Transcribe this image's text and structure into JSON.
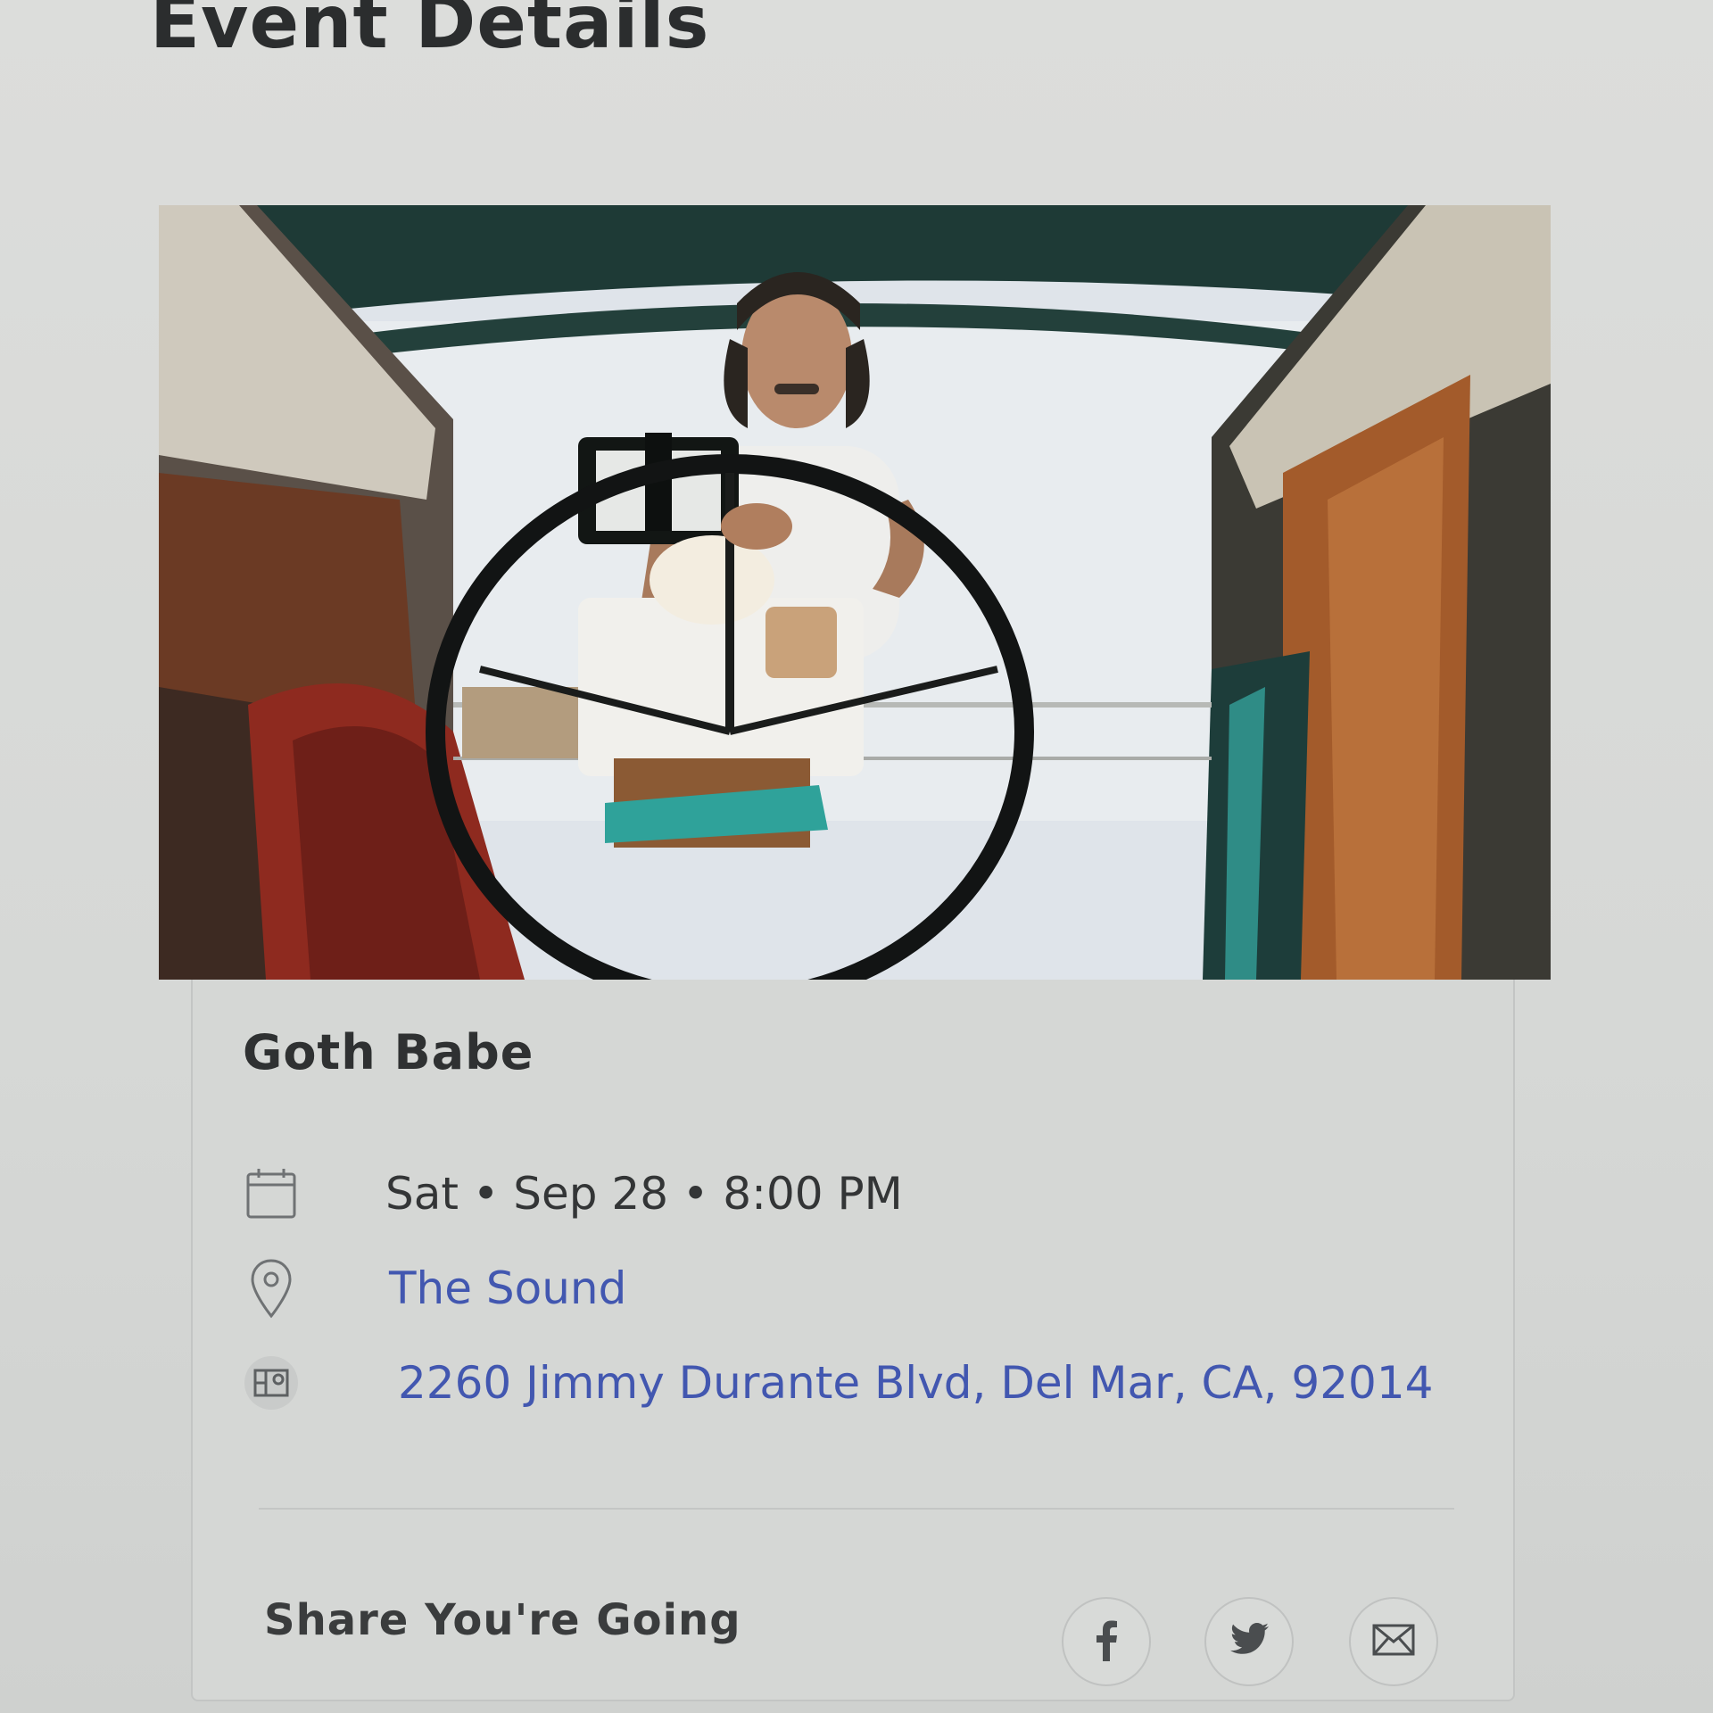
{
  "header": {
    "title": "Event Details"
  },
  "event": {
    "image_alt": "Man steering a sailboat wheel",
    "name": "Goth Babe",
    "datetime": "Sat • Sep 28 • 8:00 PM",
    "venue": "The Sound",
    "address": "2260 Jimmy Durante Blvd, Del Mar, CA, 92014"
  },
  "share": {
    "label": "Share You're Going",
    "buttons": [
      {
        "name": "facebook",
        "icon": "facebook-icon"
      },
      {
        "name": "twitter",
        "icon": "twitter-icon"
      },
      {
        "name": "email",
        "icon": "mail-icon"
      }
    ]
  },
  "colors": {
    "link": "#4257b0",
    "text": "#333536",
    "background": "#dadbd9"
  }
}
